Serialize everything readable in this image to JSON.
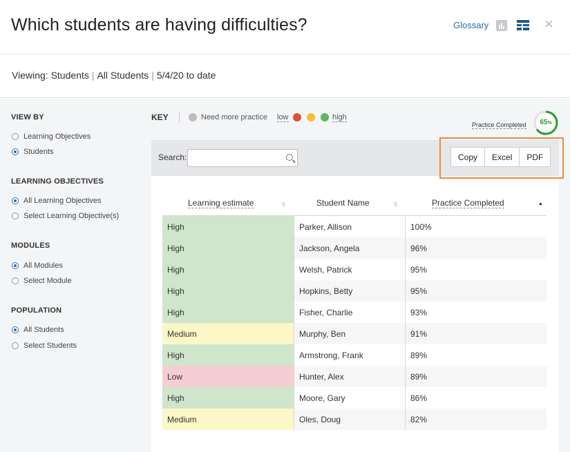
{
  "header": {
    "title": "Which students are having difficulties?",
    "glossary": "Glossary",
    "close": "×"
  },
  "viewing": {
    "prefix": "Viewing:",
    "items": [
      "Students",
      "All Students",
      "5/4/20 to date"
    ]
  },
  "sidebar": {
    "sections": [
      {
        "title": "VIEW BY",
        "options": [
          {
            "label": "Learning Objectives",
            "selected": false
          },
          {
            "label": "Students",
            "selected": true
          }
        ]
      },
      {
        "title": "LEARNING OBJECTIVES",
        "options": [
          {
            "label": "All Learning Objectives",
            "selected": true
          },
          {
            "label": "Select Learning Objective(s)",
            "selected": false
          }
        ]
      },
      {
        "title": "MODULES",
        "options": [
          {
            "label": "All Modules",
            "selected": true
          },
          {
            "label": "Select Module",
            "selected": false
          }
        ]
      },
      {
        "title": "POPULATION",
        "options": [
          {
            "label": "All Students",
            "selected": true
          },
          {
            "label": "Select Students",
            "selected": false
          }
        ]
      }
    ]
  },
  "key": {
    "title": "KEY",
    "need_more_practice": "Need more practice",
    "low": "low",
    "high": "high",
    "colors": {
      "need_more_practice": "#bdbdbd",
      "low": "#e0503a",
      "medium": "#f5bd3a",
      "high": "#5cb85c"
    }
  },
  "practice_completed": {
    "label": "Practice Completed",
    "value": 65,
    "unit": "%"
  },
  "search": {
    "label": "Search:",
    "value": "",
    "placeholder": ""
  },
  "export": {
    "copy": "Copy",
    "excel": "Excel",
    "pdf": "PDF"
  },
  "table": {
    "columns": [
      "Learning estimate",
      "Student Name",
      "Practice Completed"
    ],
    "rows": [
      {
        "level": "High",
        "name": "Parker, Allison",
        "pct": "100%"
      },
      {
        "level": "High",
        "name": "Jackson, Angela",
        "pct": "96%"
      },
      {
        "level": "High",
        "name": "Welsh, Patrick",
        "pct": "95%"
      },
      {
        "level": "High",
        "name": "Hopkins, Betty",
        "pct": "95%"
      },
      {
        "level": "High",
        "name": "Fisher, Charlie",
        "pct": "93%"
      },
      {
        "level": "Medium",
        "name": "Murphy, Ben",
        "pct": "91%"
      },
      {
        "level": "High",
        "name": "Armstrong, Frank",
        "pct": "89%"
      },
      {
        "level": "Low",
        "name": "Hunter, Alex",
        "pct": "89%"
      },
      {
        "level": "High",
        "name": "Moore, Gary",
        "pct": "86%"
      },
      {
        "level": "Medium",
        "name": "Oles, Doug",
        "pct": "82%"
      }
    ]
  }
}
